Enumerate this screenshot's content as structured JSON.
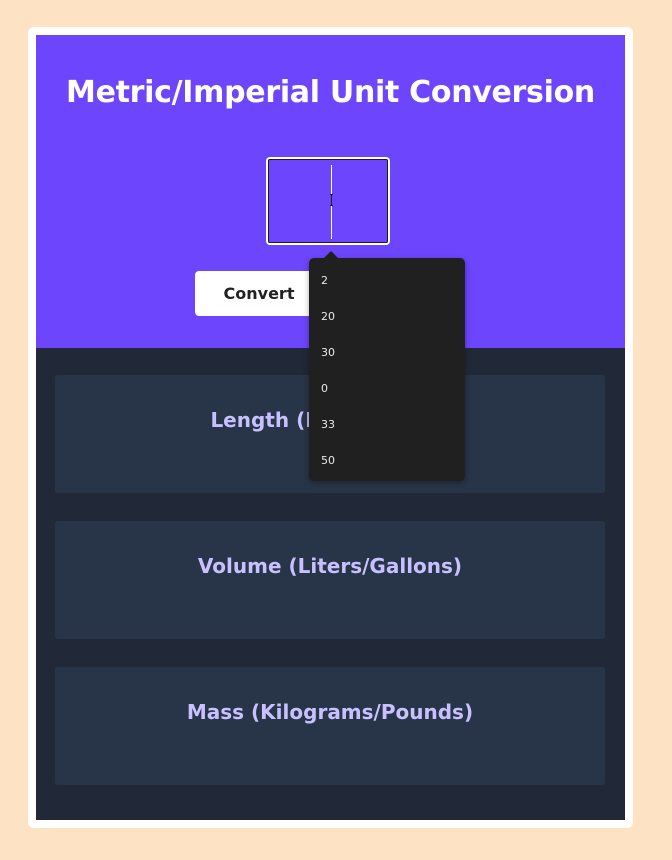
{
  "title": "Metric/Imperial Unit Conversion",
  "input": {
    "value": ""
  },
  "convert_label": "Convert",
  "sections": [
    {
      "label": "Length (Meters/Feet)"
    },
    {
      "label": "Volume (Liters/Gallons)"
    },
    {
      "label": "Mass (Kilograms/Pounds)"
    }
  ],
  "dropdown": {
    "options": [
      "2",
      "20",
      "30",
      "0",
      "33",
      "50"
    ]
  },
  "colors": {
    "page_bg": "#fde3c3",
    "header_bg": "#6d45fd",
    "body_bg": "#212838",
    "section_bg": "#283548",
    "section_text": "#c9c0ff",
    "dropdown_bg": "#1f201f"
  }
}
